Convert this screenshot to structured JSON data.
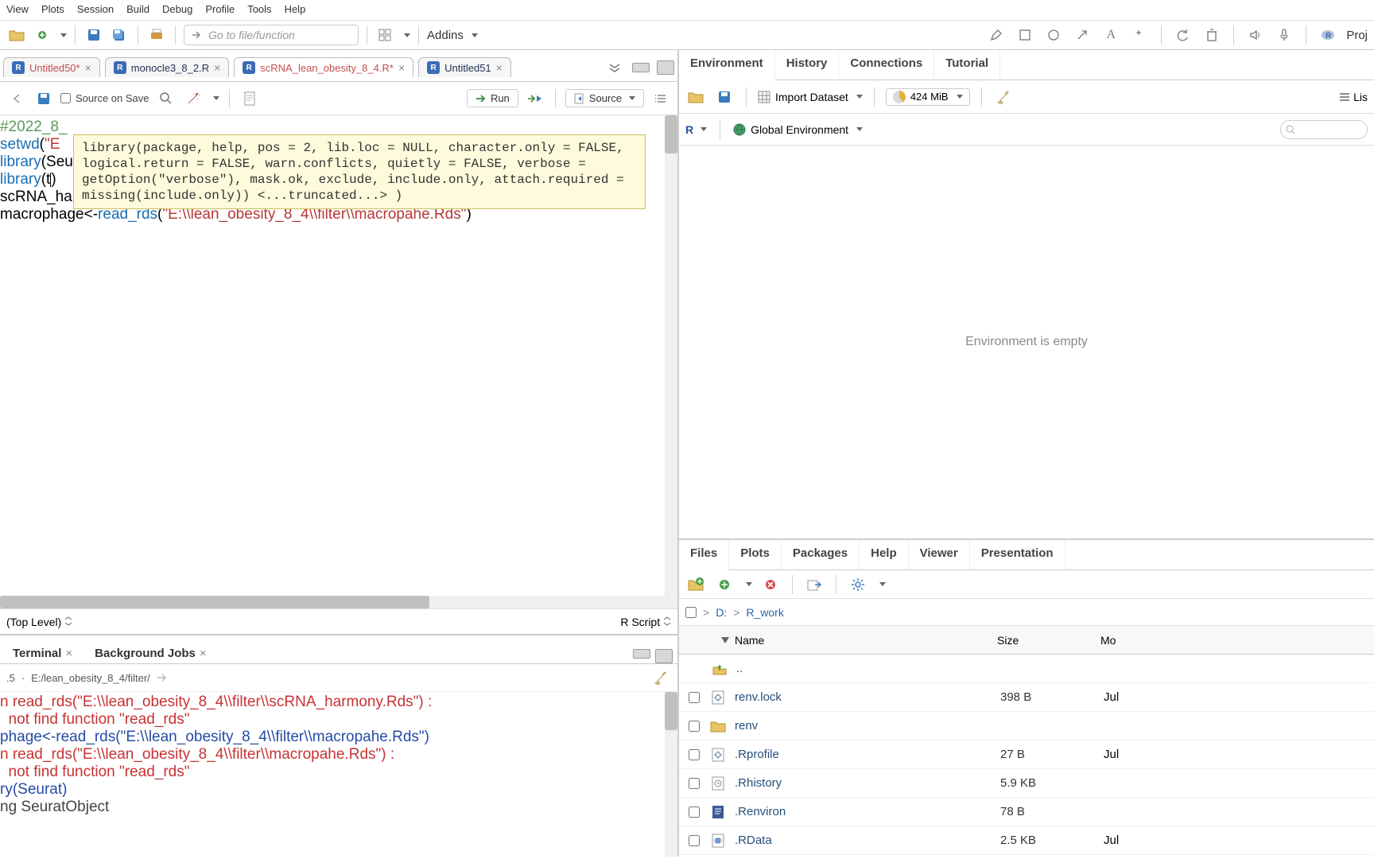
{
  "menu": [
    "View",
    "Plots",
    "Session",
    "Build",
    "Debug",
    "Profile",
    "Tools",
    "Help"
  ],
  "gotoFilePlaceholder": "Go to file/function",
  "addinsLabel": "Addins",
  "projLabel": "Proj",
  "tabs": [
    {
      "name": "Untitled50*",
      "modified": true,
      "active": false
    },
    {
      "name": "monocle3_8_2.R",
      "modified": false,
      "active": false
    },
    {
      "name": "scRNA_lean_obesity_8_4.R*",
      "modified": true,
      "active": true
    },
    {
      "name": "Untitled51",
      "modified": false,
      "active": false
    }
  ],
  "sourceOnSave": "Source on Save",
  "runLabel": "Run",
  "sourceLabel": "Source",
  "tooltip": "library(package, help, pos = 2, lib.loc = NULL, character.only = FALSE, logical.return = FALSE, warn.conflicts, quietly = FALSE, verbose = getOption(\"verbose\"), mask.ok, exclude, include.only, attach.required = missing(include.only))  <...truncated...> )",
  "code": {
    "c1_comment": "#2022_8_",
    "c2a": "setwd",
    "c2b": "(",
    "c2c": "\"E",
    "c3a": "library",
    "c3b": "(Seurat)",
    "c4a": "library",
    "c4b": "(t",
    "c4c": ")",
    "c5a": "scRNA_harmony<-",
    "c5b": "read_rds",
    "c5c": "(",
    "c5d": "\"E:\\\\lean_obesity_8_4\\\\filter\\\\scRNA_harmony.Rds",
    "c6a": "macrophage<-",
    "c6b": "read_rds",
    "c6c": "(",
    "c6d": "\"E:\\\\lean_obesity_8_4\\\\filter\\\\macropahe.Rds\"",
    "c6e": ")"
  },
  "scope": "(Top Level)",
  "lang": "R Script",
  "consoleTabs": {
    "terminal": "Terminal",
    "bg": "Background Jobs"
  },
  "conVer": ".5",
  "conPath": "E:/lean_obesity_8_4/filter/",
  "console": {
    "l1": "n read_rds(\"E:\\\\lean_obesity_8_4\\\\filter\\\\scRNA_harmony.Rds\") :",
    "l2": "  not find function \"read_rds\"",
    "l3": "phage<-read_rds(\"E:\\\\lean_obesity_8_4\\\\filter\\\\macropahe.Rds\")",
    "l4": "n read_rds(\"E:\\\\lean_obesity_8_4\\\\filter\\\\macropahe.Rds\") :",
    "l5": "  not find function \"read_rds\"",
    "l6": "ry(Seurat)",
    "l7": "ng SeuratObject"
  },
  "envTabs": [
    "Environment",
    "History",
    "Connections",
    "Tutorial"
  ],
  "importLabel": "Import Dataset",
  "memLabel": "424 MiB",
  "lisLabel": "Lis",
  "rLabel": "R",
  "globalEnv": "Global Environment",
  "envEmpty": "Environment is empty",
  "fileTabs": [
    "Files",
    "Plots",
    "Packages",
    "Help",
    "Viewer",
    "Presentation"
  ],
  "bread": {
    "root": "D:",
    "folder": "R_work"
  },
  "cols": {
    "name": "Name",
    "size": "Size",
    "mod": "Mo"
  },
  "upDir": "..",
  "files": [
    {
      "name": "renv.lock",
      "size": "398 B",
      "mod": "Jul",
      "icon": "gear-file"
    },
    {
      "name": "renv",
      "size": "",
      "mod": "",
      "icon": "folder"
    },
    {
      "name": ".Rprofile",
      "size": "27 B",
      "mod": "Jul",
      "icon": "gear-file"
    },
    {
      "name": ".Rhistory",
      "size": "5.9 KB",
      "mod": "",
      "icon": "clock-file"
    },
    {
      "name": ".Renviron",
      "size": "78 B",
      "mod": "",
      "icon": "text-file"
    },
    {
      "name": ".RData",
      "size": "2.5 KB",
      "mod": "Jul",
      "icon": "r-file"
    }
  ]
}
